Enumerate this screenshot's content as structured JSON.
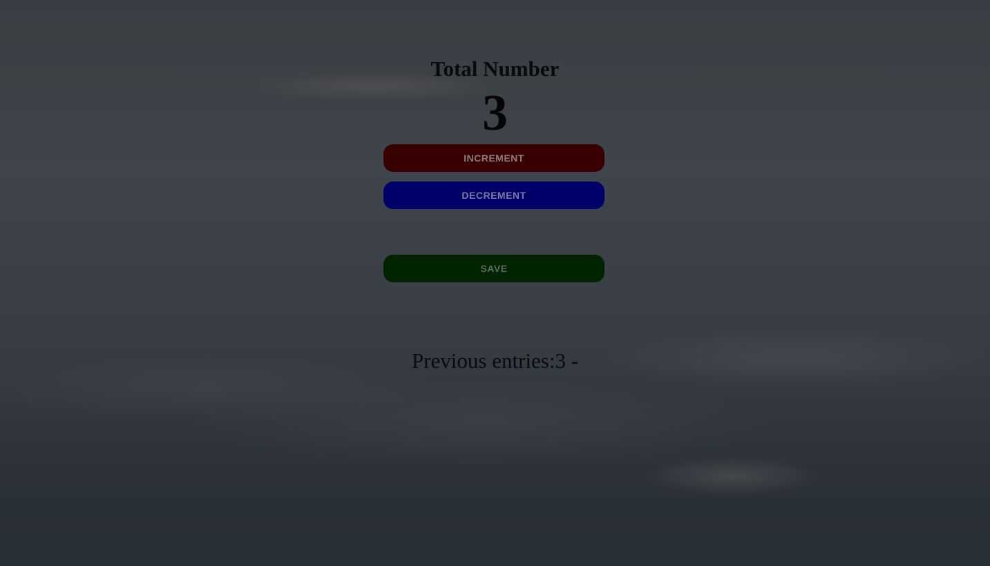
{
  "counter": {
    "title": "Total Number",
    "value": "3"
  },
  "buttons": {
    "increment_label": "INCREMENT",
    "decrement_label": "DECREMENT",
    "save_label": "SAVE"
  },
  "entries": {
    "text": "Previous entries:3 -"
  },
  "colors": {
    "increment_bg": "#380000",
    "decrement_bg": "#00006b",
    "save_bg": "#002300"
  }
}
